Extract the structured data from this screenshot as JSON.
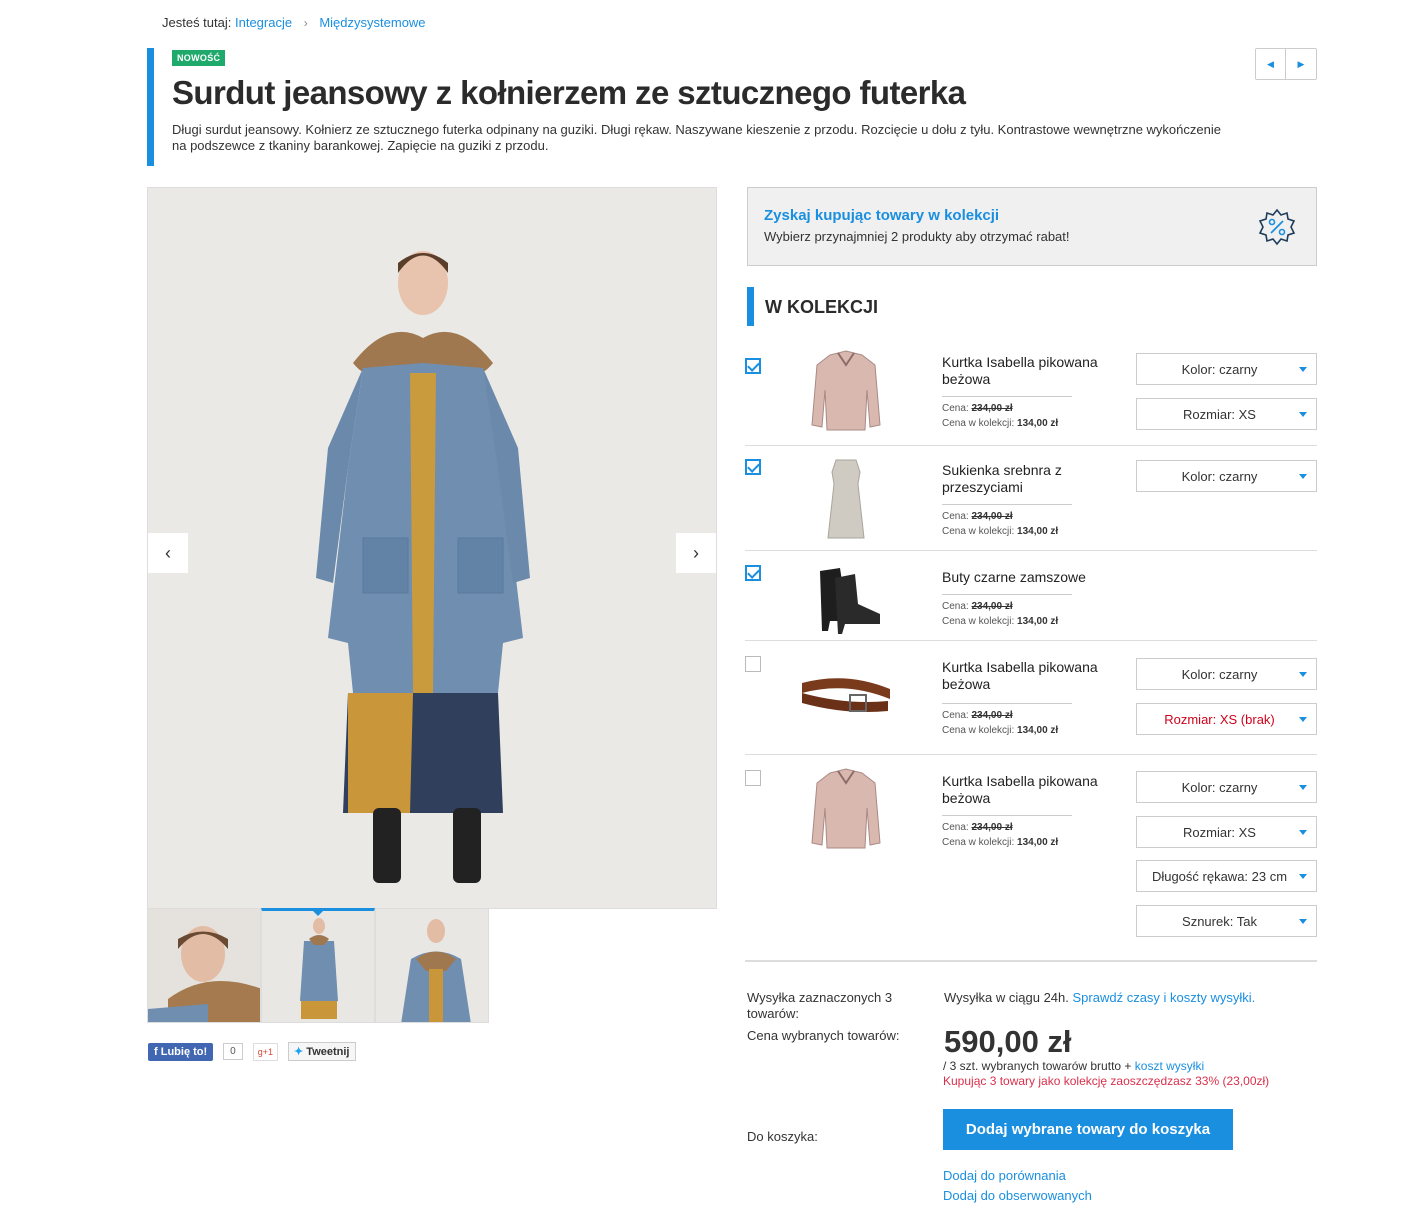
{
  "breadcrumb": {
    "prefix": "Jesteś tutaj:",
    "items": [
      "Integracje",
      "Międzysystemowe"
    ]
  },
  "product": {
    "badge": "NOWOŚĆ",
    "title": "Surdut jeansowy z kołnierzem ze sztucznego futerka",
    "description": "Długi surdut jeansowy. Kołnierz ze sztucznego futerka odpinany na guziki. Długi rękaw. Naszywane kieszenie z przodu. Rozcięcie u dołu z tyłu. Kontrastowe wewnętrzne wykończenie na podszewce z tkaniny barankowej. Zapięcie na guziki z przodu."
  },
  "gallery": {
    "prev": "‹",
    "next": "›"
  },
  "social": {
    "like": "Lubię to!",
    "like_count": "0",
    "gplus": "g+1",
    "tweet": "Tweetnij"
  },
  "promo": {
    "title": "Zyskaj kupując towary w kolekcji",
    "subtitle": "Wybierz przynajmniej 2 produkty aby otrzymać rabat!"
  },
  "section_title": "W KOLEKCJI",
  "price_labels": {
    "price": "Cena:",
    "collection_price": "Cena w kolekcji:"
  },
  "items": [
    {
      "name": "Kurtka Isabella pikowana beżowa",
      "checked": true,
      "price": "234,00 zł",
      "collection_price": "134,00 zł",
      "options": [
        "Kolor: czarny",
        "Rozmiar: XS"
      ]
    },
    {
      "name": "Sukienka srebnra z przeszyciami",
      "checked": true,
      "price": "234,00 zł",
      "collection_price": "134,00 zł",
      "options": [
        "Kolor: czarny"
      ]
    },
    {
      "name": "Buty czarne zamszowe",
      "checked": true,
      "price": "234,00 zł",
      "collection_price": "134,00 zł",
      "options": []
    },
    {
      "name": "Kurtka Isabella pikowana beżowa",
      "checked": false,
      "price": "234,00 zł",
      "collection_price": "134,00 zł",
      "options": [
        "Kolor: czarny",
        "Rozmiar: XS (brak)"
      ]
    },
    {
      "name": "Kurtka Isabella pikowana beżowa",
      "checked": false,
      "price": "234,00 zł",
      "collection_price": "134,00 zł",
      "options": [
        "Kolor: czarny",
        "Rozmiar: XS",
        "Długość rękawa: 23 cm",
        "Sznurek: Tak"
      ]
    }
  ],
  "summary": {
    "shipping_label": "Wysyłka zaznaczonych 3 towarów:",
    "shipping_text": "Wysyłka w ciągu 24h.",
    "shipping_link": "Sprawdź czasy i koszty wysyłki.",
    "price_label": "Cena wybranych towarów:",
    "total": "590,00 zł",
    "total_note": "/ 3 szt. wybranych towarów brutto +",
    "shipping_cost_link": "koszt wysyłki",
    "savings": "Kupując 3 towary jako kolekcję zaoszczędzasz 33% (23,00zł)",
    "cart_label": "Do koszyka:",
    "add_button": "Dodaj wybrane towary do koszyka",
    "compare_link": "Dodaj do porównania",
    "watch_link": "Dodaj do obserwowanych"
  },
  "colors": {
    "accent": "#1a8fe0",
    "badge": "#1fa96b",
    "error": "#d0021b",
    "savings": "#d9304c"
  }
}
